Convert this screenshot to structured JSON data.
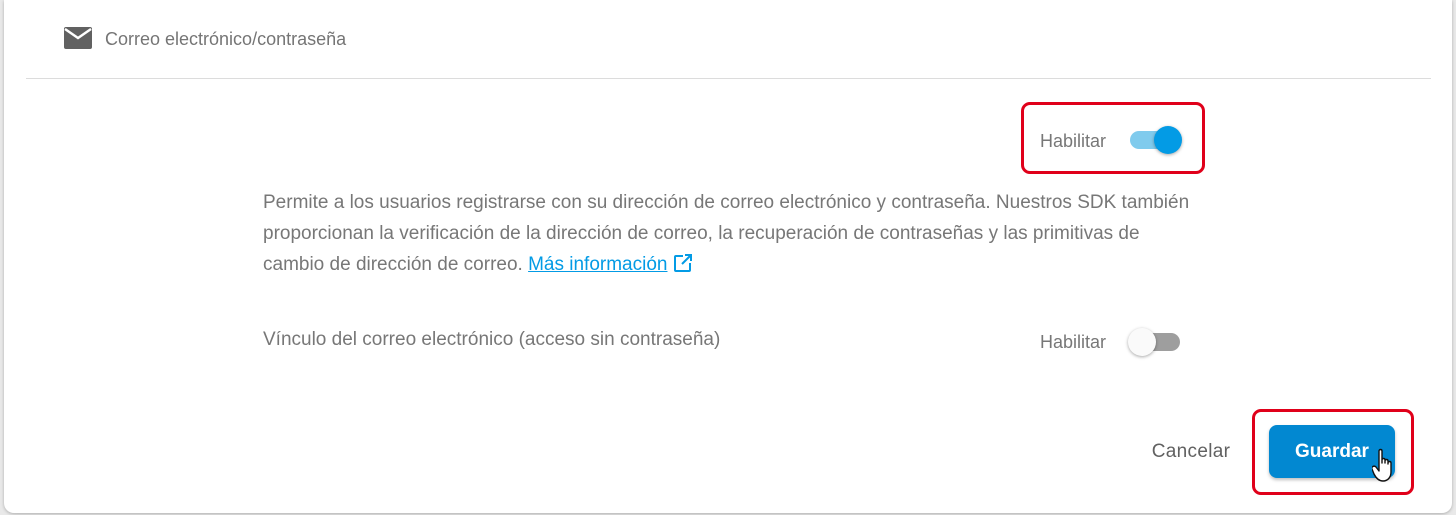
{
  "header": {
    "icon": "mail-icon",
    "title": "Correo electrónico/contraseña"
  },
  "email_password": {
    "toggle_label": "Habilitar",
    "enabled": true,
    "description": "Permite a los usuarios registrarse con su dirección de correo electrónico y contraseña. Nuestros SDK también proporcionan la verificación de la dirección de correo, la recuperación de contraseñas y las primitivas de cambio de dirección de correo.",
    "link_text": "Más información",
    "link_icon": "open-in-new-icon"
  },
  "email_link": {
    "label": "Vínculo del correo electrónico (acceso sin contraseña)",
    "toggle_label": "Habilitar",
    "enabled": false
  },
  "actions": {
    "cancel_label": "Cancelar",
    "save_label": "Guardar"
  },
  "colors": {
    "accent": "#039be5",
    "primary_button": "#0288d1",
    "highlight": "#e0001a"
  }
}
